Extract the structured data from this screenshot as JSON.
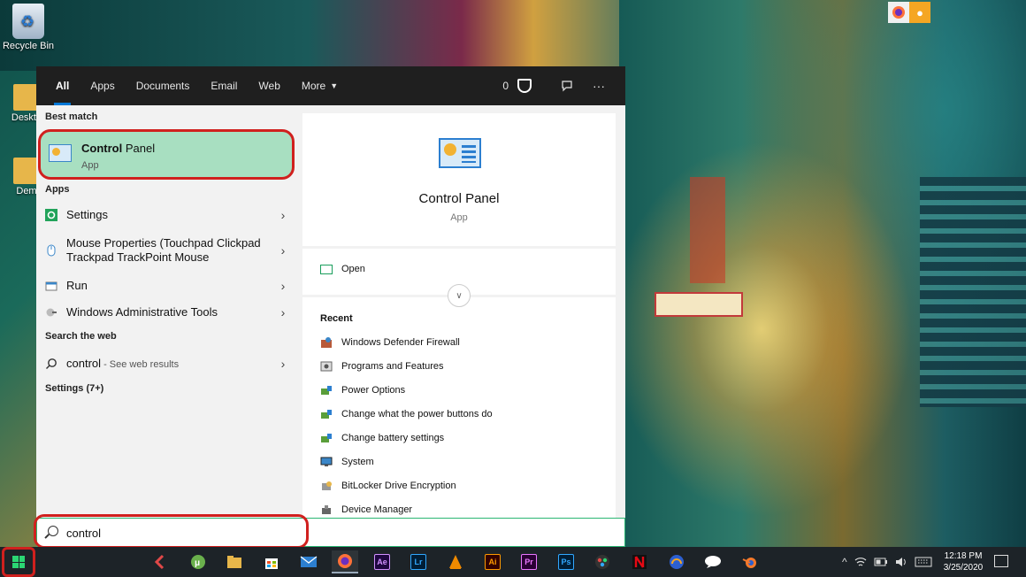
{
  "desktop": {
    "icons": [
      {
        "label": "Recycle Bin"
      },
      {
        "label": "Deskto"
      },
      {
        "label": "Dem"
      }
    ]
  },
  "search_panel": {
    "tabs": [
      {
        "label": "All",
        "active": true
      },
      {
        "label": "Apps"
      },
      {
        "label": "Documents"
      },
      {
        "label": "Email"
      },
      {
        "label": "Web"
      },
      {
        "label": "More"
      }
    ],
    "points": "0",
    "best_match": {
      "heading": "Best match",
      "title_bold": "Control",
      "title_rest": " Panel",
      "subtitle": "App"
    },
    "apps_heading": "Apps",
    "apps": [
      {
        "label": "Settings",
        "icon": "gear-icon"
      },
      {
        "label": "Mouse Properties (Touchpad Clickpad Trackpad TrackPoint Mouse",
        "icon": "mouse-icon"
      },
      {
        "label": "Run",
        "icon": "run-icon"
      },
      {
        "label": "Windows Administrative Tools",
        "icon": "tools-icon"
      }
    ],
    "web_heading": "Search the web",
    "web_result": {
      "query": "control",
      "suffix": " - See web results"
    },
    "settings_heading": "Settings (7+)",
    "preview": {
      "title": "Control Panel",
      "subtitle": "App",
      "open_label": "Open",
      "recent_heading": "Recent",
      "recent": [
        "Windows Defender Firewall",
        "Programs and Features",
        "Power Options",
        "Change what the power buttons do",
        "Change battery settings",
        "System",
        "BitLocker Drive Encryption",
        "Device Manager"
      ]
    }
  },
  "search_box": {
    "value": "control"
  },
  "taskbar": {
    "apps": [
      "Ae",
      "Lr",
      "Ai",
      "Pr",
      "Ps"
    ],
    "time": "12:18 PM",
    "date": "3/25/2020"
  },
  "colors": {
    "highlight_green": "#a8dfc1",
    "annotation_red": "#d0201e",
    "accent_blue": "#0078d7"
  }
}
